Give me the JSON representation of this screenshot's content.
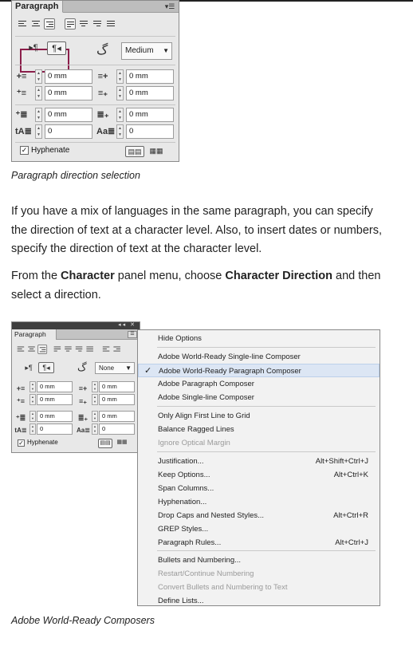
{
  "panel1": {
    "title": "Paragraph",
    "menu_glyph": "▾☰",
    "direction_ltr": "▸¶",
    "direction_rtl": "¶◂",
    "composer_icon": "ﮒ",
    "composer_value": "Medium",
    "fields": {
      "left_indent": "0 mm",
      "right_indent": "0 mm",
      "first_line_indent": "0 mm",
      "last_line_indent": "0 mm",
      "space_before": "0 mm",
      "space_after": "0 mm",
      "drop_cap_lines": "0",
      "drop_cap_chars": "0"
    },
    "hyphenate_label": "Hyphenate",
    "hyphenate_checked": "✓"
  },
  "caption1": "Paragraph direction selection",
  "para1": "If you have a mix of languages in the same paragraph, you can specify the direction of text at a character level. Also, to insert dates or numbers, specify the direction of text at the character level.",
  "para2": {
    "prefix": "From the ",
    "bold1": "Character",
    "middle": " panel menu, choose ",
    "bold2": "Character Direction",
    "suffix": " and then select a direction."
  },
  "panel2": {
    "title": "Paragraph",
    "collapse_glyph": "◂◂ ✕",
    "menu_glyph": "☰",
    "composer_value": "None",
    "fields": {
      "left_indent": "0 mm",
      "right_indent": "0 mm",
      "first_line_indent": "0 mm",
      "last_line_indent": "0 mm",
      "space_before": "0 mm",
      "space_after": "0 mm",
      "drop_cap_lines": "0",
      "drop_cap_chars": "0"
    },
    "hyphenate_label": "Hyphenate"
  },
  "menu": {
    "checkmark": "✓",
    "items": [
      {
        "label": "Hide Options",
        "shortcut": "",
        "disabled": false
      },
      {
        "label": "Adobe World-Ready Single-line Composer",
        "shortcut": "",
        "disabled": false
      },
      {
        "label": "Adobe World-Ready Paragraph Composer",
        "shortcut": "",
        "disabled": false,
        "checked": true
      },
      {
        "label": "Adobe Paragraph Composer",
        "shortcut": "",
        "disabled": false
      },
      {
        "label": "Adobe Single-line Composer",
        "shortcut": "",
        "disabled": false
      },
      {
        "label": "Only Align First Line to Grid",
        "shortcut": "",
        "disabled": false
      },
      {
        "label": "Balance Ragged Lines",
        "shortcut": "",
        "disabled": false
      },
      {
        "label": "Ignore Optical Margin",
        "shortcut": "",
        "disabled": true
      },
      {
        "label": "Justification...",
        "shortcut": "Alt+Shift+Ctrl+J",
        "disabled": false
      },
      {
        "label": "Keep Options...",
        "shortcut": "Alt+Ctrl+K",
        "disabled": false
      },
      {
        "label": "Span Columns...",
        "shortcut": "",
        "disabled": false
      },
      {
        "label": "Hyphenation...",
        "shortcut": "",
        "disabled": false
      },
      {
        "label": "Drop Caps and Nested Styles...",
        "shortcut": "Alt+Ctrl+R",
        "disabled": false
      },
      {
        "label": "GREP Styles...",
        "shortcut": "",
        "disabled": false
      },
      {
        "label": "Paragraph Rules...",
        "shortcut": "Alt+Ctrl+J",
        "disabled": false
      },
      {
        "label": "Bullets and Numbering...",
        "shortcut": "",
        "disabled": false
      },
      {
        "label": "Restart/Continue Numbering",
        "shortcut": "",
        "disabled": true
      },
      {
        "label": "Convert Bullets and Numbering to Text",
        "shortcut": "",
        "disabled": true
      },
      {
        "label": "Define Lists...",
        "shortcut": "",
        "disabled": false
      }
    ]
  },
  "caption2": "Adobe World-Ready Composers",
  "colors": {
    "highlight_border": "#8b1e4a",
    "menu_highlight": "#dce6f4",
    "panel_bg": "#e8e8e8"
  }
}
